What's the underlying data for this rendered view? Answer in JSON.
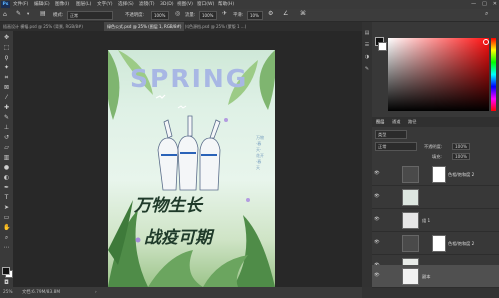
{
  "app": {
    "logo": "Ps"
  },
  "menu": [
    "文件(F)",
    "编辑(E)",
    "图像(I)",
    "图层(L)",
    "文字(Y)",
    "选择(S)",
    "滤镜(T)",
    "3D(D)",
    "视图(V)",
    "窗口(W)",
    "帮助(H)"
  ],
  "window_controls": [
    "—",
    "□",
    "✕"
  ],
  "options_bar": {
    "mode_label": "模式:",
    "mode_value": "正常",
    "opacity_label": "不透明度:",
    "opacity_value": "100%",
    "flow_label": "流量:",
    "flow_value": "100%",
    "smooth_label": "平滑:",
    "smooth_value": "10%"
  },
  "tabs": [
    {
      "label": "插画设计 横幅.psd @ 25% (背景, RGB/8#)",
      "active": false
    },
    {
      "label": "绿色公式.psd @ 25% (图层 1, RGB/8#)",
      "active": true
    },
    {
      "label": "抖色源档.psd @ 25% (蒙版 1 ...)",
      "active": false
    }
  ],
  "tools": [
    "move-tool",
    "marquee-tool",
    "lasso-tool",
    "quick-select-tool",
    "crop-tool",
    "frame-tool",
    "eyedropper-tool",
    "healing-tool",
    "brush-tool",
    "stamp-tool",
    "history-brush-tool",
    "eraser-tool",
    "gradient-tool",
    "blur-tool",
    "dodge-tool",
    "pen-tool",
    "type-tool",
    "path-select-tool",
    "shape-tool",
    "hand-tool",
    "zoom-tool",
    "more-tools"
  ],
  "artwork": {
    "headline": "SPRING",
    "line1": "万物生长",
    "line2": "战疫可期",
    "side_text": "万物·春天·花开·春天"
  },
  "status": {
    "zoom": "25%",
    "doc_info": "文档:6.79M/83.8M"
  },
  "layers": {
    "tabs": [
      "图层",
      "通道",
      "路径"
    ],
    "filter_label": "类型",
    "blend_mode": "正常",
    "opacity_label": "不透明度:",
    "opacity_value": "100%",
    "fill_label": "填充:",
    "fill_value": "100%",
    "rows": [
      {
        "name": "色相/饱和度 2",
        "selected": false
      },
      {
        "name": "",
        "selected": false
      },
      {
        "name": "组 1",
        "selected": false
      },
      {
        "name": "色相/饱和度 2",
        "selected": false
      },
      {
        "name": "",
        "selected": false
      },
      {
        "name": "副本",
        "selected": true
      }
    ]
  },
  "colors": {
    "accent": "#ff1010",
    "panel_bg": "#383838"
  }
}
